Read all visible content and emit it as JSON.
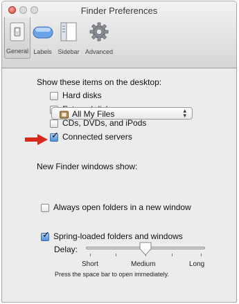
{
  "window": {
    "title": "Finder Preferences"
  },
  "toolbar": {
    "tabs": [
      {
        "label": "General",
        "icon": "light-switch-icon",
        "selected": true
      },
      {
        "label": "Labels",
        "icon": "labels-icon",
        "selected": false
      },
      {
        "label": "Sidebar",
        "icon": "sidebar-icon",
        "selected": false
      },
      {
        "label": "Advanced",
        "icon": "gear-icon",
        "selected": false
      }
    ]
  },
  "desktop_items": {
    "heading": "Show these items on the desktop:",
    "items": [
      {
        "label": "Hard disks",
        "checked": false
      },
      {
        "label": "External disks",
        "checked": false
      },
      {
        "label": "CDs, DVDs, and iPods",
        "checked": false
      },
      {
        "label": "Connected servers",
        "checked": true
      }
    ]
  },
  "new_window": {
    "label": "New Finder windows show:",
    "selected": "All My Files"
  },
  "always_open": {
    "label": "Always open folders in a new window",
    "checked": false
  },
  "spring_loaded": {
    "label": "Spring-loaded folders and windows",
    "checked": true,
    "delay_label": "Delay:",
    "scale_labels": [
      "Short",
      "Medium",
      "Long"
    ],
    "value": "Medium",
    "hint": "Press the space bar to open immediately."
  },
  "colors": {
    "arrow": "#d9291c",
    "checkbox_accent": "#4e8fd8"
  }
}
